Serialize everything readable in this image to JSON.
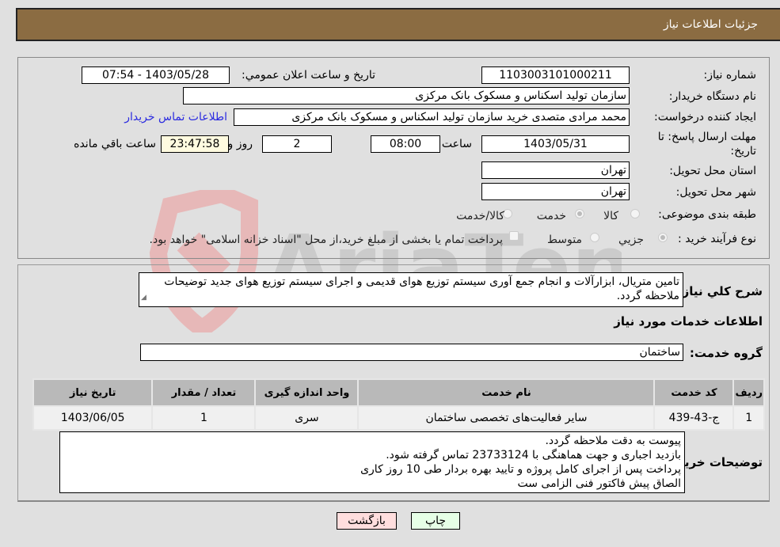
{
  "header": {
    "title": "جزئیات اطلاعات نیاز"
  },
  "form": {
    "need_number_label": "شماره نیاز:",
    "need_number": "1103003101000211",
    "announce_label": "تاریخ و ساعت اعلان عمومي:",
    "announce_value": "1403/05/28 - 07:54",
    "buyer_org_label": "نام دستگاه خریدار:",
    "buyer_org": "سازمان تولید اسکناس و مسکوک بانک مرکزی",
    "creator_label": "ایجاد کننده درخواست:",
    "creator": "محمد مرادی متصدی خرید سازمان تولید اسکناس و مسکوک بانک مرکزی",
    "buyer_contact_link": "اطلاعات تماس خریدار",
    "deadline_label_line1": "مهلت ارسال پاسخ: تا",
    "deadline_label_line2": "تاریخ:",
    "deadline_date": "1403/05/31",
    "time_label": "ساعت",
    "deadline_time": "08:00",
    "days_value": "2",
    "days_label": "روز و",
    "remaining_time": "23:47:58",
    "remaining_label": "ساعت باقي مانده",
    "province_label": "استان محل تحویل:",
    "province": "تهران",
    "city_label": "شهر محل تحویل:",
    "city": "تهران",
    "category_label": "طبقه بندی موضوعی:",
    "category_options": [
      {
        "label": "کالا",
        "checked": false
      },
      {
        "label": "خدمت",
        "checked": true
      },
      {
        "label": "کالا/خدمت",
        "checked": false
      }
    ],
    "process_label": "نوع فرآیند خرید :",
    "process_options": [
      {
        "label": "جزيي",
        "checked": true
      },
      {
        "label": "متوسط",
        "checked": false
      }
    ],
    "treasury_checkbox_label": "پرداخت تمام یا بخشی از مبلغ خرید،از محل \"اسناد خزانه اسلامی\" خواهد بود."
  },
  "details": {
    "description_label": "شرح کلي نیاز:",
    "description": "تامین متریال، ابزارآلات و انجام جمع آوری سیستم توزیع هوای قدیمی و اجرای سیستم توزیع هوای جدید توضیحات ملاحظه گردد.",
    "services_heading": "اطلاعات خدمات مورد نیاز",
    "service_group_label": "گروه خدمت:",
    "service_group": "ساختمان",
    "table": {
      "headers": [
        "ردیف",
        "کد خدمت",
        "نام خدمت",
        "واحد اندازه گیری",
        "تعداد / مقدار",
        "تاریخ نیاز"
      ],
      "rows": [
        [
          "1",
          "ج-43-439",
          "سایر فعالیت‌های تخصصی ساختمان",
          "سری",
          "1",
          "1403/06/05"
        ]
      ]
    },
    "buyer_notes_label": "توضیحات خریدار:",
    "buyer_notes": [
      "پیوست به دقت ملاحظه گردد.",
      "بازدید اجباری و جهت هماهنگی با 23733124 تماس گرفته شود.",
      "پرداخت پس از اجرای کامل پروژه و تایید بهره بردار طی 10 روز کاری",
      "الصاق پیش فاکتور فنی الزامی ست"
    ]
  },
  "buttons": {
    "print": "چاپ",
    "back": "بازگشت"
  },
  "watermark": {
    "text": "AriaTender.neT"
  }
}
